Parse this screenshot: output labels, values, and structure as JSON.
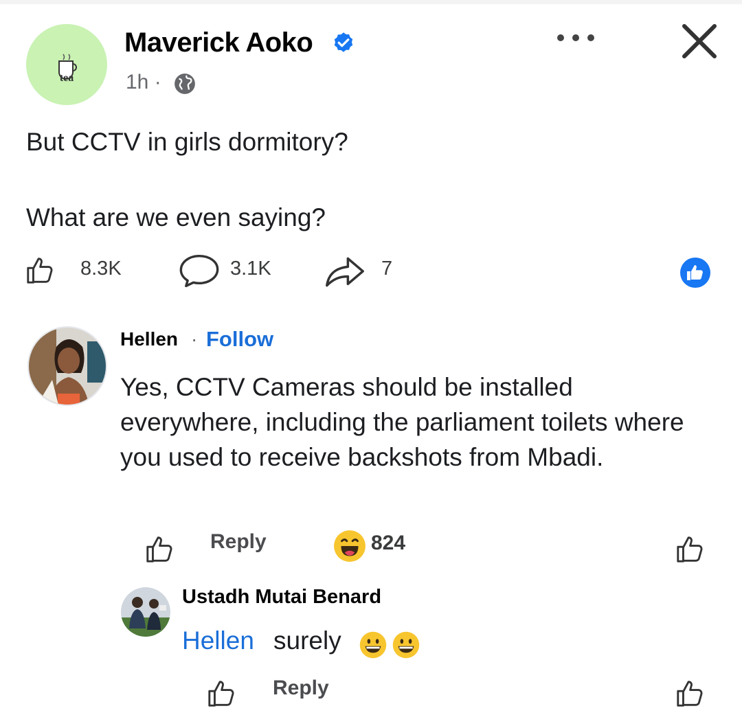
{
  "post": {
    "author": "Maverick Aoko",
    "time": "1h ·",
    "avatar_label": "tea",
    "lines": [
      "But CCTV in girls dormitory?",
      "What are we even saying?"
    ],
    "likes": "8.3K",
    "comments": "3.1K",
    "shares": "7"
  },
  "comment1": {
    "author": "Hellen",
    "separator": "·",
    "follow_label": "Follow",
    "text": "Yes, CCTV Cameras should be installed everywhere, including the parliament toilets where you used to receive backshots from Mbadi.",
    "reply_label": "Reply",
    "reaction_count": "824"
  },
  "comment2": {
    "author": "Ustadh Mutai Benard",
    "mention": "Hellen",
    "text": "surely",
    "reply_label": "Reply"
  },
  "icons": {
    "verified": "verified-badge-icon",
    "privacy": "globe-icon",
    "more": "more-options-icon",
    "close": "close-icon",
    "like": "thumbs-up-outline-icon",
    "comment": "comment-bubble-icon",
    "share": "share-arrow-icon",
    "like_badge": "like-reaction-badge-icon",
    "haha": "haha-reaction-icon",
    "emoji": "grinning-face-emoji-icon"
  },
  "colors": {
    "accent_blue": "#1a6ed8",
    "avatar_green": "#c9f2b3",
    "text": "#1c1e21",
    "secondary": "#65676b"
  }
}
